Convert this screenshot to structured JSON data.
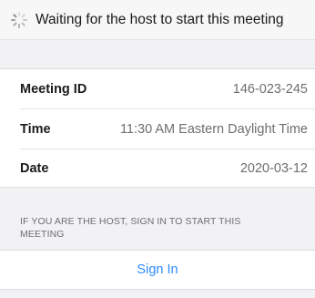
{
  "header": {
    "title": "Waiting for the host to start this meeting",
    "icon": "loading-spinner-icon"
  },
  "meeting": {
    "rows": [
      {
        "label": "Meeting ID",
        "value": "146-023-245"
      },
      {
        "label": "Time",
        "value": "11:30 AM Eastern Daylight Time"
      },
      {
        "label": "Date",
        "value": "2020-03-12"
      }
    ]
  },
  "host_note": "IF YOU ARE THE HOST, SIGN IN TO START THIS MEETING",
  "sign_in": {
    "label": "Sign In",
    "color": "#2d8cff"
  }
}
